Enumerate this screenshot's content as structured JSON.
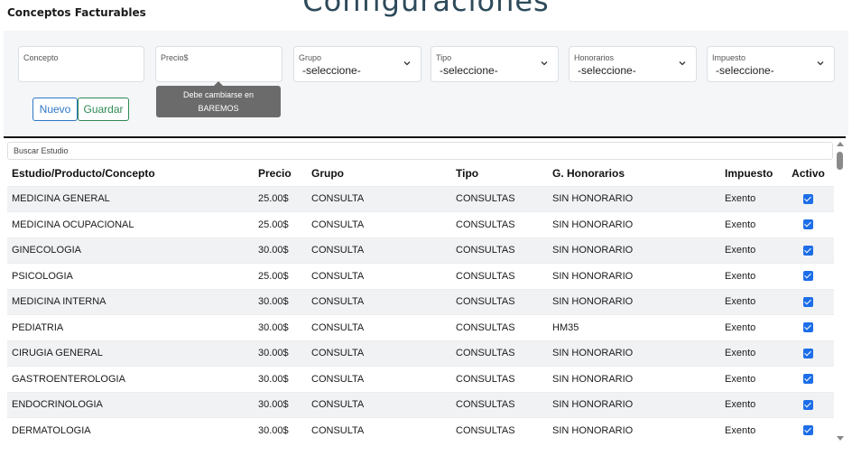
{
  "page": {
    "title": "Configuraciones",
    "section_title": "Conceptos Facturables"
  },
  "form": {
    "concepto": {
      "label": "Concepto",
      "value": ""
    },
    "precio": {
      "label": "Precio$",
      "value": ""
    },
    "grupo": {
      "label": "Grupo",
      "value": "-seleccione-"
    },
    "tipo": {
      "label": "Tipo",
      "value": "-seleccione-"
    },
    "honorarios": {
      "label": "Honorarios",
      "value": "-seleccione-"
    },
    "impuesto": {
      "label": "Impuesto",
      "value": "-seleccione-"
    },
    "tooltip_line1": "Debe cambiarse en",
    "tooltip_line2": "BAREMOS",
    "nuevo_label": "Nuevo",
    "guardar_label": "Guardar"
  },
  "search": {
    "placeholder": "Buscar Estudio"
  },
  "table": {
    "headers": {
      "concepto": "Estudio/Producto/Concepto",
      "precio": "Precio",
      "grupo": "Grupo",
      "tipo": "Tipo",
      "honorarios": "G. Honorarios",
      "impuesto": "Impuesto",
      "activo": "Activo"
    },
    "rows": [
      {
        "concepto": "MEDICINA GENERAL",
        "precio": "25.00$",
        "grupo": "CONSULTA",
        "tipo": "CONSULTAS",
        "honorarios": "SIN HONORARIO",
        "impuesto": "Exento",
        "activo": true
      },
      {
        "concepto": "MEDICINA OCUPACIONAL",
        "precio": "25.00$",
        "grupo": "CONSULTA",
        "tipo": "CONSULTAS",
        "honorarios": "SIN HONORARIO",
        "impuesto": "Exento",
        "activo": true
      },
      {
        "concepto": "GINECOLOGIA",
        "precio": "30.00$",
        "grupo": "CONSULTA",
        "tipo": "CONSULTAS",
        "honorarios": "SIN HONORARIO",
        "impuesto": "Exento",
        "activo": true
      },
      {
        "concepto": "PSICOLOGIA",
        "precio": "25.00$",
        "grupo": "CONSULTA",
        "tipo": "CONSULTAS",
        "honorarios": "SIN HONORARIO",
        "impuesto": "Exento",
        "activo": true
      },
      {
        "concepto": "MEDICINA INTERNA",
        "precio": "30.00$",
        "grupo": "CONSULTA",
        "tipo": "CONSULTAS",
        "honorarios": "SIN HONORARIO",
        "impuesto": "Exento",
        "activo": true
      },
      {
        "concepto": "PEDIATRIA",
        "precio": "30.00$",
        "grupo": "CONSULTA",
        "tipo": "CONSULTAS",
        "honorarios": "HM35",
        "impuesto": "Exento",
        "activo": true
      },
      {
        "concepto": "CIRUGIA GENERAL",
        "precio": "30.00$",
        "grupo": "CONSULTA",
        "tipo": "CONSULTAS",
        "honorarios": "SIN HONORARIO",
        "impuesto": "Exento",
        "activo": true
      },
      {
        "concepto": "GASTROENTEROLOGIA",
        "precio": "30.00$",
        "grupo": "CONSULTA",
        "tipo": "CONSULTAS",
        "honorarios": "SIN HONORARIO",
        "impuesto": "Exento",
        "activo": true
      },
      {
        "concepto": "ENDOCRINOLOGIA",
        "precio": "30.00$",
        "grupo": "CONSULTA",
        "tipo": "CONSULTAS",
        "honorarios": "SIN HONORARIO",
        "impuesto": "Exento",
        "activo": true
      },
      {
        "concepto": "DERMATOLOGIA",
        "precio": "30.00$",
        "grupo": "CONSULTA",
        "tipo": "CONSULTAS",
        "honorarios": "SIN HONORARIO",
        "impuesto": "Exento",
        "activo": true
      },
      {
        "concepto": "",
        "precio": "",
        "grupo": "",
        "tipo": "",
        "honorarios": "",
        "impuesto": "",
        "activo": false
      }
    ]
  },
  "colors": {
    "accent_blue": "#2e78c7",
    "accent_green": "#2f8a55",
    "checkbox_blue": "#1d6ee8",
    "title_color": "#2d4a5a"
  },
  "icons": {
    "select_arrow": "chevron-down-icon",
    "checkbox": "checkbox-checked-icon",
    "scroll_up": "scroll-up-arrow-icon",
    "scroll_down": "scroll-down-arrow-icon"
  }
}
